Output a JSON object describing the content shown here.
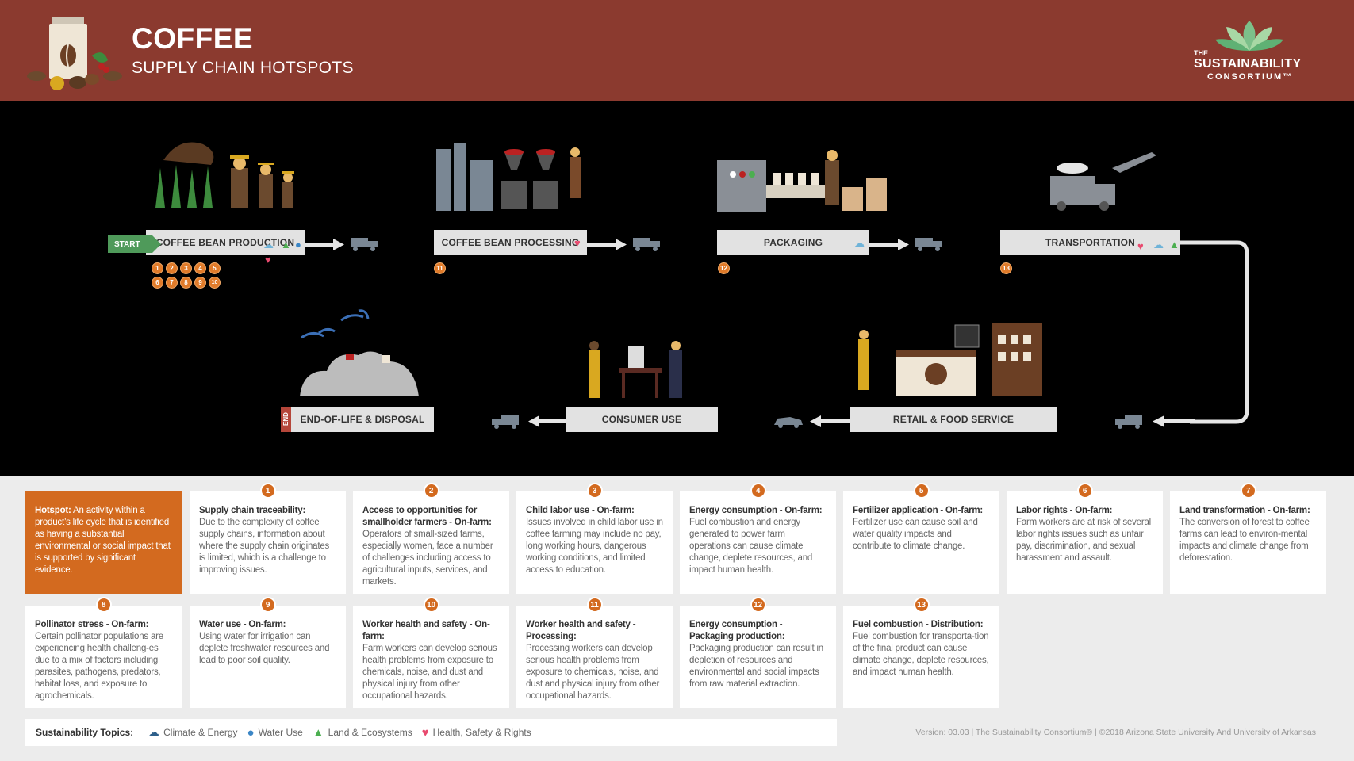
{
  "header": {
    "title": "COFFEE",
    "subtitle": "SUPPLY CHAIN HOTSPOTS",
    "brand_the": "THE",
    "brand_name": "SUSTAINABILITY",
    "brand_sub": "CONSORTIUM™"
  },
  "diagram": {
    "start_label": "START",
    "end_label": "END",
    "stages": [
      {
        "label": "COFFEE BEAN PRODUCTION",
        "hotspots": [
          "1",
          "2",
          "3",
          "4",
          "5",
          "6",
          "7",
          "8",
          "9",
          "10"
        ]
      },
      {
        "label": "COFFEE BEAN PROCESSING",
        "hotspots": [
          "11"
        ]
      },
      {
        "label": "PACKAGING",
        "hotspots": [
          "12"
        ]
      },
      {
        "label": "TRANSPORTATION",
        "hotspots": [
          "13"
        ]
      },
      {
        "label": "RETAIL & FOOD SERVICE",
        "hotspots": []
      },
      {
        "label": "CONSUMER USE",
        "hotspots": []
      },
      {
        "label": "END-OF-LIFE & DISPOSAL",
        "hotspots": []
      }
    ]
  },
  "cards": {
    "hotspot_def": {
      "title": "Hotspot:",
      "text": "An activity within a product’s life cycle that is identified as having a substantial environmental or social impact that is supported by significant evidence."
    },
    "items": [
      {
        "num": "1",
        "title": "Supply chain traceability:",
        "text": "Due to the complexity of coffee supply chains, information about where the supply chain originates is limited, which is a challenge to improving issues."
      },
      {
        "num": "2",
        "title": "Access to opportunities for smallholder farmers - On-farm:",
        "text": "Operators of small-sized farms, especially women, face a number of challenges including access to agricultural inputs, services, and markets."
      },
      {
        "num": "3",
        "title": "Child labor use - On-farm:",
        "text": "Issues involved in child labor use in coffee farming may include no pay, long working hours, dangerous working conditions, and limited access to education."
      },
      {
        "num": "4",
        "title": "Energy consumption - On-farm:",
        "text": "Fuel combustion and energy generated to power farm operations can cause climate change, deplete resources, and impact human health."
      },
      {
        "num": "5",
        "title": "Fertilizer application - On-farm:",
        "text": "Fertilizer use can cause soil and water quality impacts and contribute to climate change."
      },
      {
        "num": "6",
        "title": "Labor rights - On-farm:",
        "text": "Farm workers are at risk of several labor rights issues such as unfair pay, discrimination, and sexual harassment and assault."
      },
      {
        "num": "7",
        "title": "Land transformation - On-farm:",
        "text": "The conversion of forest to coffee farms can lead to environ-mental impacts and climate change from deforestation."
      },
      {
        "num": "8",
        "title": "Pollinator stress - On-farm:",
        "text": "Certain pollinator populations are experiencing health challeng-es due to a mix of factors including parasites, pathogens, predators, habitat loss, and exposure to agrochemicals."
      },
      {
        "num": "9",
        "title": "Water use - On-farm:",
        "text": "Using water for irrigation can deplete freshwater resources and lead to poor soil quality."
      },
      {
        "num": "10",
        "title": "Worker health and safety - On-farm:",
        "text": "Farm workers can develop serious health problems from exposure to chemicals, noise, and dust and physical injury from other occupational hazards."
      },
      {
        "num": "11",
        "title": "Worker health and safety - Processing:",
        "text": "Processing workers can develop serious health problems from exposure to chemicals, noise, and dust and physical injury from other occupational hazards."
      },
      {
        "num": "12",
        "title": "Energy consumption - Packaging production:",
        "text": "Packaging production can result in depletion of resources and environmental and social impacts from raw material extraction."
      },
      {
        "num": "13",
        "title": "Fuel combustion - Distribution:",
        "text": "Fuel combustion for transporta-tion of the final product can cause climate change, deplete resources, and impact human health."
      }
    ]
  },
  "legend": {
    "title": "Sustainability Topics:",
    "items": [
      {
        "icon": "climate-energy-icon",
        "label": "Climate & Energy"
      },
      {
        "icon": "water-drop-icon",
        "label": "Water Use"
      },
      {
        "icon": "tree-icon",
        "label": "Land & Ecosystems"
      },
      {
        "icon": "heart-icon",
        "label": "Health, Safety & Rights"
      }
    ]
  },
  "footer": "Version: 03.03  |  The Sustainability Consortium®  |  ©2018 Arizona State University And University of Arkansas",
  "colors": {
    "header": "#8b3a2f",
    "accent": "#d36a1f",
    "start": "#4f9a5a",
    "diagram_bg": "#000000"
  }
}
